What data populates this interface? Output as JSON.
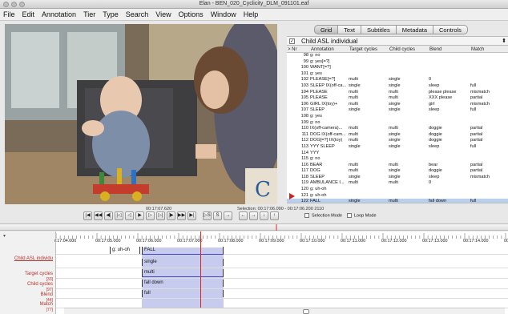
{
  "window": {
    "title": "Elan - BEN_020_Cyclicity_DLM_091101.eaf"
  },
  "menu": [
    "File",
    "Edit",
    "Annotation",
    "Tier",
    "Type",
    "Search",
    "View",
    "Options",
    "Window",
    "Help"
  ],
  "tabs": [
    {
      "label": "Grid",
      "active": true
    },
    {
      "label": "Text",
      "active": false
    },
    {
      "label": "Subtitles",
      "active": false
    },
    {
      "label": "Metadata",
      "active": false
    },
    {
      "label": "Controls",
      "active": false
    }
  ],
  "tier_selector": {
    "checked": "✓",
    "value": "Child ASL individual",
    "arrows": "⬍"
  },
  "grid": {
    "columns": [
      "> Nr",
      "Annotation",
      "Target cycles",
      "Child cycles",
      "Blend",
      "Match"
    ],
    "rows": [
      [
        "98",
        "g: no",
        "",
        "",
        "",
        ""
      ],
      [
        "99",
        "g: yes[=?]",
        "",
        "",
        "",
        ""
      ],
      [
        "100",
        "WANT[=?]",
        "",
        "",
        "",
        ""
      ],
      [
        "101",
        "g: yes",
        "",
        "",
        "",
        ""
      ],
      [
        "102",
        "PLEASE[=?]",
        "multi",
        "single",
        "0",
        ""
      ],
      [
        "103",
        "SLEEP IX(off-ca...",
        "single",
        "single",
        "sleep",
        "full"
      ],
      [
        "104",
        "PLEASE",
        "multi",
        "multi",
        "please please",
        "mismatch"
      ],
      [
        "105",
        "PLEASE",
        "multi",
        "multi",
        "XXX please",
        "partial"
      ],
      [
        "106",
        "GIRL IX(toy)+",
        "multi",
        "single",
        "girl",
        "mismatch"
      ],
      [
        "107",
        "SLEEP",
        "single",
        "single",
        "sleep",
        "full"
      ],
      [
        "108",
        "g: yes",
        "",
        "",
        "",
        ""
      ],
      [
        "109",
        "g: no",
        "",
        "",
        "",
        ""
      ],
      [
        "110",
        "IX(off-camera)...",
        "multi",
        "multi",
        "doggie",
        "partial"
      ],
      [
        "111",
        "DOG IX(off-cam...",
        "multi",
        "single",
        "doggie",
        "partial"
      ],
      [
        "112",
        "DOG[=?] IX(toy)",
        "multi",
        "single",
        "doggie",
        "partial"
      ],
      [
        "113",
        "YYY SLEEP",
        "single",
        "single",
        "sleep",
        "full"
      ],
      [
        "114",
        "YYY",
        "",
        "",
        "",
        ""
      ],
      [
        "115",
        "g: no",
        "",
        "",
        "",
        ""
      ],
      [
        "116",
        "BEAR",
        "multi",
        "multi",
        "bear",
        "partial"
      ],
      [
        "117",
        "DOG",
        "multi",
        "single",
        "doggie",
        "partial"
      ],
      [
        "118",
        "SLEEP",
        "single",
        "single",
        "sleep",
        "mismatch"
      ],
      [
        "119",
        "AMBULANCE I...",
        "multi",
        "multi",
        "0",
        ""
      ],
      [
        "120",
        "g: uh-oh",
        "",
        "",
        "",
        ""
      ],
      [
        "121",
        "g: uh-oh",
        "",
        "",
        "",
        ""
      ],
      [
        "122",
        "FALL",
        "single",
        "multi",
        "fall down",
        "full"
      ]
    ],
    "current_row": 24
  },
  "media": {
    "current_time": "00:17:07.620",
    "selection": "Selection: 00:17:06.090 - 00:17:06.200  2110"
  },
  "controls": {
    "buttons": [
      {
        "name": "go-to-begin",
        "glyph": "|◀"
      },
      {
        "name": "previous-scroll-view",
        "glyph": "◀◀"
      },
      {
        "name": "previous-second",
        "glyph": "◀|"
      },
      {
        "name": "previous-frame",
        "glyph": "|◁"
      },
      {
        "name": "previous-pixel",
        "glyph": "◁"
      },
      {
        "name": "play-pause",
        "glyph": "▶"
      },
      {
        "name": "next-pixel",
        "glyph": "▷"
      },
      {
        "name": "next-frame",
        "glyph": "▷|"
      },
      {
        "name": "next-second",
        "glyph": "|▶"
      },
      {
        "name": "next-scroll-view",
        "glyph": "▶▶"
      },
      {
        "name": "go-to-end",
        "glyph": "▶|"
      },
      {
        "name": "play-selection",
        "glyph": "▷S",
        "gap": true
      },
      {
        "name": "clear-selection",
        "glyph": "S"
      },
      {
        "name": "selection-bound",
        "glyph": "→"
      },
      {
        "name": "step-left",
        "glyph": "←",
        "gap": true
      },
      {
        "name": "step-right",
        "glyph": "→"
      },
      {
        "name": "step-down",
        "glyph": "↓"
      },
      {
        "name": "step-up",
        "glyph": "↑"
      }
    ],
    "selection_mode_label": "Selection Mode",
    "loop_mode_label": "Loop Mode"
  },
  "timeline": {
    "ruler": [
      "r:17:04.000",
      "00:17:05.000",
      "00:17:06.000",
      "00:17:07.000",
      "00:17:08.000",
      "00:17:09.000",
      "00:17:10.000",
      "00:17:11.000",
      "00:17:12.000",
      "00:17:13.000",
      "00:17:14.000",
      "00:17:15.000"
    ],
    "tiers": [
      {
        "name": "Child ASL individu",
        "count": ""
      },
      {
        "name": "Target cycles",
        "count": "[33]"
      },
      {
        "name": "Child cycles",
        "count": "[97]"
      },
      {
        "name": "Blend",
        "count": "[44]"
      },
      {
        "name": "Match",
        "count": "[77]"
      }
    ],
    "segments": {
      "uhoh": "g: uh-oh",
      "fall": "FALL",
      "target": "single",
      "child": "multi",
      "blend": "fall down",
      "match": "full"
    }
  },
  "colors": {
    "selection": "#c7ccee",
    "crosshair": "#e02020",
    "tier_label": "#b0302a",
    "current_row": "#b9cfee"
  }
}
